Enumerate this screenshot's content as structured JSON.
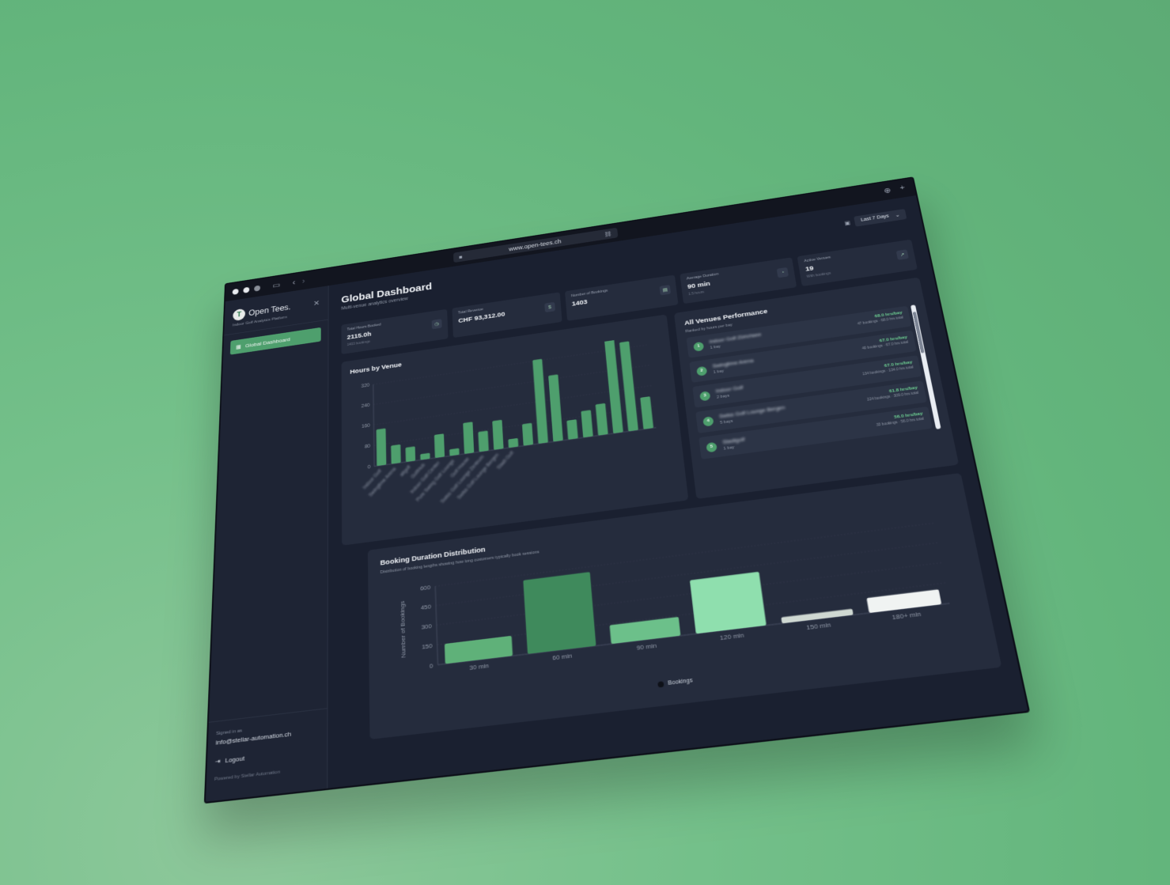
{
  "browser": {
    "url": "www.open-tees.ch",
    "icons": [
      "lock-icon",
      "link-icon",
      "download-icon",
      "plus-icon",
      "sidebar-toggle-icon",
      "back-icon",
      "forward-icon"
    ]
  },
  "sidebar": {
    "brand": "Open Tees.",
    "logo_letter": "T",
    "tagline": "Indoor Golf Analytics Platform",
    "nav_items": [
      {
        "label": "Global Dashboard",
        "active": true
      }
    ],
    "signed_in_label": "Signed in as",
    "email": "info@stellar-automation.ch",
    "logout_label": "Logout",
    "powered_by": "Powered by Stellar Automation"
  },
  "header": {
    "title": "Global Dashboard",
    "subtitle": "Multi-venue analytics overview",
    "date_filter": "Last 7 Days"
  },
  "stats": [
    {
      "label": "Total Hours Booked",
      "value": "2115.0h",
      "sub": "1403 bookings",
      "icon": "clock-icon"
    },
    {
      "label": "Total Revenue",
      "value": "CHF 93,312.00",
      "sub": "",
      "icon": "dollar-icon"
    },
    {
      "label": "Number of Bookings",
      "value": "1403",
      "sub": "",
      "icon": "calendar-icon"
    },
    {
      "label": "Average Duration",
      "value": "90 min",
      "sub": "1.5 hours",
      "icon": "timer-icon"
    },
    {
      "label": "Active Venues",
      "value": "19",
      "sub": "With bookings",
      "icon": "trend-icon"
    }
  ],
  "hours_by_venue": {
    "title": "Hours by Venue",
    "chart_data": {
      "type": "bar",
      "title": "Hours by Venue",
      "categories": [
        "Indoor Golf",
        "Swingtime Arena",
        "allgolf",
        "GolfHub",
        "Indoor Golf Center",
        "Pure Swing Golf Lounge",
        "Golf House",
        "Swiss Golf Lounge Zentrum",
        "Swiss Golf Lounge Bergen",
        "Stadt Golf",
        "",
        "",
        "",
        "",
        "",
        "",
        "",
        "",
        ""
      ],
      "values": [
        140,
        70,
        55,
        22,
        88,
        25,
        118,
        76,
        110,
        32,
        82,
        325,
        255,
        72,
        100,
        118,
        385,
        345,
        120
      ],
      "ylim": [
        0,
        320
      ],
      "yticks": [
        0,
        80,
        160,
        240,
        320
      ],
      "color": "#4e9f6d"
    }
  },
  "venues_performance": {
    "title": "All Venues Performance",
    "subtitle": "Ranked by hours per bay",
    "venues": [
      {
        "rank": "1",
        "name": "Indoor Golf Zürichsee",
        "bays": "1 bay",
        "rate": "68.0 hrs/bay",
        "meta": "47 bookings · 68.0 hrs total"
      },
      {
        "rank": "2",
        "name": "Swingtime Arena",
        "bays": "1 bay",
        "rate": "67.0 hrs/bay",
        "meta": "40 bookings · 67.0 hrs total"
      },
      {
        "rank": "3",
        "name": "Indoor Golf",
        "bays": "2 bays",
        "rate": "67.0 hrs/bay",
        "meta": "134 bookings · 134.0 hrs total"
      },
      {
        "rank": "4",
        "name": "Swiss Golf Lounge Bergen",
        "bays": "5 bays",
        "rate": "61.8 hrs/bay",
        "meta": "224 bookings · 309.0 hrs total"
      },
      {
        "rank": "5",
        "name": "Stadtgolf",
        "bays": "1 bay",
        "rate": "56.0 hrs/bay",
        "meta": "33 bookings · 56.0 hrs total"
      }
    ]
  },
  "duration_distribution": {
    "title": "Booking Duration Distribution",
    "subtitle": "Distribution of booking lengths showing how long customers typically book sessions",
    "legend": "Bookings",
    "chart_data": {
      "type": "bar",
      "title": "Booking Duration Distribution",
      "categories": [
        "30 min",
        "60 min",
        "90 min",
        "120 min",
        "150 min",
        "180+ min"
      ],
      "values": [
        150,
        560,
        140,
        400,
        45,
        110
      ],
      "colors": [
        "#5fb179",
        "#3f8a5c",
        "#6cc08a",
        "#8fdfae",
        "#cfd8d2",
        "#f0f3f2"
      ],
      "ylabel": "Number of Bookings",
      "ylim": [
        0,
        600
      ],
      "yticks": [
        0,
        150,
        300,
        450,
        600
      ]
    }
  }
}
